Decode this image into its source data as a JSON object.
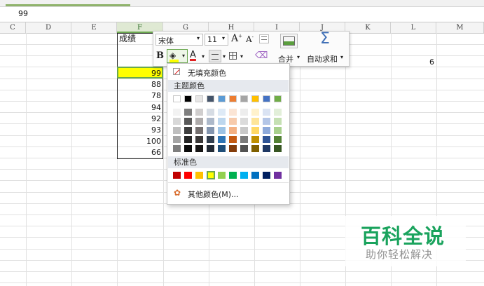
{
  "formula_bar": {
    "value": "99"
  },
  "columns": [
    "C",
    "D",
    "E",
    "F",
    "G",
    "H",
    "I",
    "J",
    "K",
    "L",
    "M"
  ],
  "selected_column": "F",
  "sheet": {
    "f_header": "成绩",
    "f_values": [
      "99",
      "88",
      "78",
      "94",
      "92",
      "93",
      "100",
      "66"
    ],
    "l_value": "6"
  },
  "toolbar": {
    "font_name": "宋体",
    "font_size": "11",
    "grow_font": "A",
    "shrink_font": "A",
    "bold": "B",
    "font_color_letter": "A",
    "merge_label": "合并",
    "autosum_label": "自动求和",
    "sum_symbol": "Σ"
  },
  "color_popup": {
    "no_fill": "无填充颜色",
    "theme_header": "主题颜色",
    "standard_header": "标准色",
    "more_colors": "其他颜色(M)...",
    "theme_top": [
      "#ffffff",
      "#000000",
      "#e7e6e6",
      "#44546a",
      "#5b9bd5",
      "#ed7d31",
      "#a5a5a5",
      "#ffc000",
      "#4472c4",
      "#70ad47"
    ],
    "theme_shades": [
      [
        "#f2f2f2",
        "#7f7f7f",
        "#d0cece",
        "#d6dce4",
        "#deeaf6",
        "#fbe5d5",
        "#ededed",
        "#fff2cc",
        "#dae3f3",
        "#e2efd9"
      ],
      [
        "#d8d8d8",
        "#595959",
        "#aeabab",
        "#adb9ca",
        "#bdd7ee",
        "#f7cbac",
        "#dbdbdb",
        "#fee599",
        "#b4c6e7",
        "#c5e0b3"
      ],
      [
        "#bfbfbf",
        "#3f3f3f",
        "#757070",
        "#8496b0",
        "#9cc3e5",
        "#f4b183",
        "#c9c9c9",
        "#ffd965",
        "#8eaadb",
        "#a8d08d"
      ],
      [
        "#a5a5a5",
        "#262626",
        "#3a3838",
        "#323f4f",
        "#2e75b5",
        "#c55a11",
        "#7b7b7b",
        "#bf9000",
        "#2f5496",
        "#538135"
      ],
      [
        "#7f7f7f",
        "#0c0c0c",
        "#171616",
        "#222a35",
        "#1f4e79",
        "#833c0b",
        "#525252",
        "#7f6000",
        "#1f3864",
        "#375623"
      ]
    ],
    "standard": [
      "#c00000",
      "#ff0000",
      "#ffc000",
      "#ffff00",
      "#92d050",
      "#00b050",
      "#00b0f0",
      "#0070c0",
      "#002060",
      "#7030a0"
    ],
    "selected_standard": "#ffff00"
  },
  "watermark": {
    "line1": "百科全说",
    "line2": "助你轻松解决"
  },
  "colors": {
    "accent_green": "#6aa84f",
    "highlight": "#ffff00",
    "sum_blue": "#3f6fb6"
  }
}
